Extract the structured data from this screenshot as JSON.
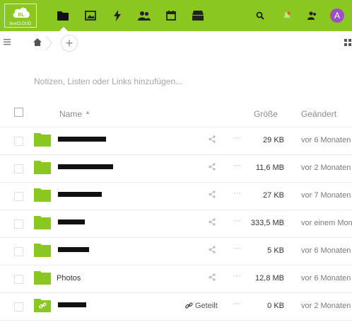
{
  "app": {
    "logo_text": "boxCLOUD",
    "logo_mark": "BL",
    "user_initial": "A"
  },
  "nav": [
    {
      "icon": "files-icon",
      "active": true
    },
    {
      "icon": "photos-icon"
    },
    {
      "icon": "activity-icon"
    },
    {
      "icon": "contacts-icon"
    },
    {
      "icon": "calendar-icon"
    },
    {
      "icon": "archive-icon"
    }
  ],
  "header_right": [
    "search-icon",
    "notifications-icon",
    "contacts-menu-icon"
  ],
  "breadcrumb": {
    "home": "home-icon",
    "add": "+"
  },
  "notes": {
    "placeholder": "Notizen, Listen oder Links hinzufügen..."
  },
  "table": {
    "columns": {
      "name": "Name",
      "sort": "▲",
      "size": "Größe",
      "modified": "Geändert"
    },
    "rows": [
      {
        "name": "",
        "redacted": true,
        "redact_w": 68,
        "size": "29 KB",
        "modified": "vor 6 Monaten",
        "shared": false,
        "link": false
      },
      {
        "name": "",
        "redacted": true,
        "redact_w": 78,
        "size": "11,6 MB",
        "modified": "vor 2 Monaten",
        "shared": false,
        "link": false
      },
      {
        "name": "",
        "redacted": true,
        "redact_w": 62,
        "size": "27 KB",
        "modified": "vor 7 Monaten",
        "shared": false,
        "link": false
      },
      {
        "name": "",
        "redacted": true,
        "redact_w": 38,
        "size": "333,5 MB",
        "modified": "vor einem Mona",
        "shared": false,
        "link": false
      },
      {
        "name": "",
        "redacted": true,
        "redact_w": 44,
        "size": "5 KB",
        "modified": "vor 6 Monaten",
        "shared": false,
        "link": false
      },
      {
        "name": "Photos",
        "redacted": false,
        "size": "12,8 MB",
        "modified": "vor 6 Monaten",
        "shared": false,
        "link": false
      },
      {
        "name": "",
        "redacted": true,
        "redact_w": 40,
        "size": "0 KB",
        "modified": "vor 2 Monaten",
        "shared": true,
        "shared_label": "Geteilt",
        "link": true
      }
    ]
  },
  "colors": {
    "accent": "#8ac821",
    "folder": "#8ac821",
    "avatar": "#9c4fc6"
  }
}
